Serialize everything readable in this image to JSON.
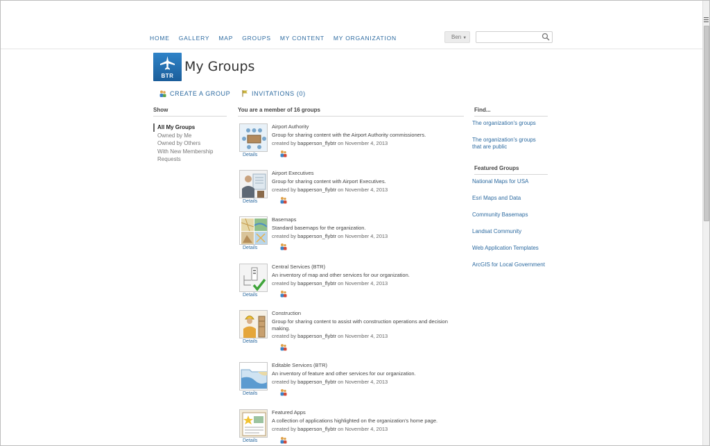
{
  "nav": {
    "items": [
      "HOME",
      "GALLERY",
      "MAP",
      "GROUPS",
      "MY CONTENT",
      "MY ORGANIZATION"
    ]
  },
  "user": {
    "name": "Ben"
  },
  "search": {
    "placeholder": ""
  },
  "header": {
    "logo_text": "BTR",
    "title": "My Groups"
  },
  "actions": {
    "create_group": "CREATE A GROUP",
    "invitations": "INVITATIONS (0)"
  },
  "show": {
    "heading": "Show",
    "items": [
      "All My Groups",
      "Owned by Me",
      "Owned by Others",
      "With New Membership",
      "Requests"
    ]
  },
  "member_heading": "You are a member of 16 groups",
  "groups": [
    {
      "title": "Airport Authority",
      "desc": "Group for sharing content with the Airport Authority commissioners.",
      "created_prefix": "created by",
      "owner": "bapperson_flybtr",
      "date_text": "on November 4, 2013",
      "details": "Details"
    },
    {
      "title": "Airport Executives",
      "desc": "Group for sharing content with Airport Executives.",
      "created_prefix": "created by",
      "owner": "bapperson_flybtr",
      "date_text": "on November 4, 2013",
      "details": "Details"
    },
    {
      "title": "Basemaps",
      "desc": "Standard basemaps for the organization.",
      "created_prefix": "created by",
      "owner": "bapperson_flybtr",
      "date_text": "on November 4, 2013",
      "details": "Details"
    },
    {
      "title": "Central Services (BTR)",
      "desc": "An inventory of map and other services for our organization.",
      "created_prefix": "created by",
      "owner": "bapperson_flybtr",
      "date_text": "on November 4, 2013",
      "details": "Details"
    },
    {
      "title": "Construction",
      "desc": "Group for sharing content to assist with construction operations and decision making.",
      "created_prefix": "created by",
      "owner": "bapperson_flybtr",
      "date_text": "on November 4, 2013",
      "details": "Details"
    },
    {
      "title": "Editable Services (BTR)",
      "desc": "An inventory of feature and other services for our organization.",
      "created_prefix": "created by",
      "owner": "bapperson_flybtr",
      "date_text": "on November 4, 2013",
      "details": "Details"
    },
    {
      "title": "Featured Apps",
      "desc": "A collection of applications highlighted on the organization's home page.",
      "created_prefix": "created by",
      "owner": "bapperson_flybtr",
      "date_text": "on November 4, 2013",
      "details": "Details"
    }
  ],
  "find": {
    "heading": "Find...",
    "links": [
      "The organization's groups",
      "The organization's groups that are public"
    ]
  },
  "featured": {
    "heading": "Featured Groups",
    "links": [
      "National Maps for USA",
      "Esri Maps and Data",
      "Community Basemaps",
      "Landsat Community",
      "Web Application Templates",
      "ArcGIS for Local Government"
    ]
  },
  "colors": {
    "link": "#2c6aa0",
    "logo": "#1f6aad"
  }
}
